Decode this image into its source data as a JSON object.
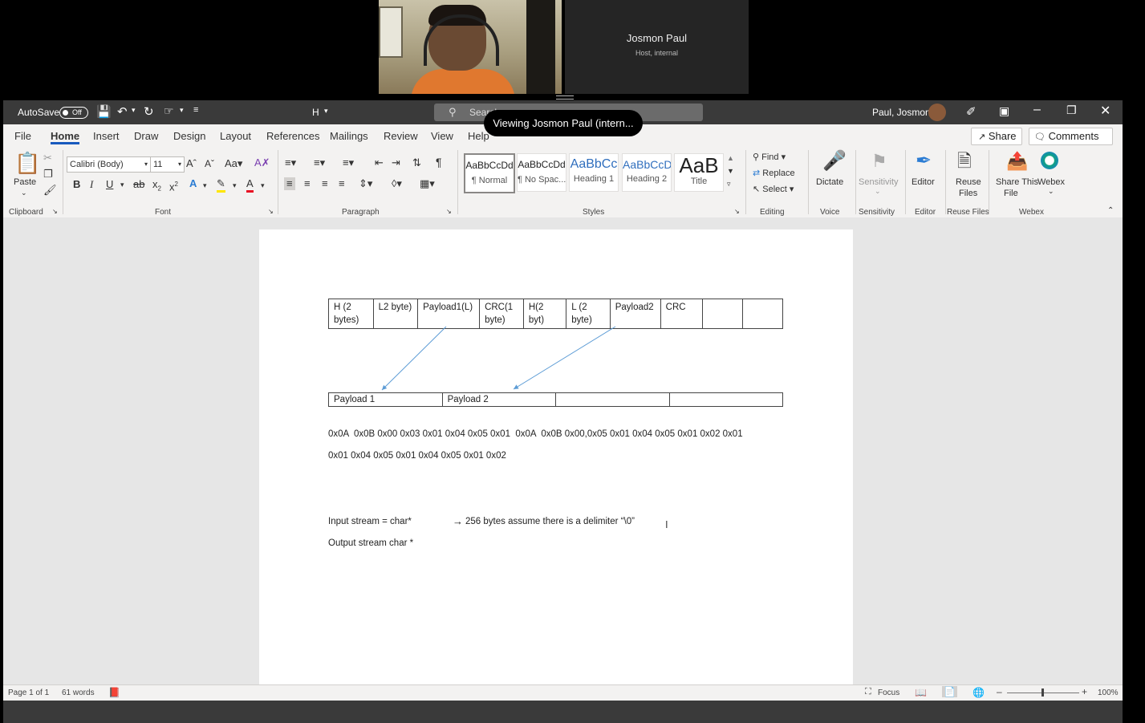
{
  "meeting": {
    "host_name": "Josmon Paul",
    "host_role": "Host, internal",
    "viewing_pill": "Viewing Josmon Paul (intern..."
  },
  "titlebar": {
    "autosave_label": "AutoSave",
    "autosave_state": "Off",
    "doc_title": "H",
    "search_placeholder": "Search",
    "user_name": "Paul, Josmon"
  },
  "tabs": [
    "File",
    "Home",
    "Insert",
    "Draw",
    "Design",
    "Layout",
    "References",
    "Mailings",
    "Review",
    "View",
    "Help"
  ],
  "share_label": "Share",
  "comments_label": "Comments",
  "ribbon": {
    "clipboard": {
      "paste": "Paste",
      "label": "Clipboard"
    },
    "font": {
      "name": "Calibri (Body)",
      "size": "11",
      "label": "Font"
    },
    "paragraph": {
      "label": "Paragraph"
    },
    "styles": {
      "label": "Styles",
      "items": [
        {
          "sample": "AaBbCcDd",
          "name": "¶ Normal"
        },
        {
          "sample": "AaBbCcDd",
          "name": "¶ No Spac..."
        },
        {
          "sample": "AaBbCc",
          "name": "Heading 1"
        },
        {
          "sample": "AaBbCcD",
          "name": "Heading 2"
        },
        {
          "sample": "AaB",
          "name": "Title"
        }
      ]
    },
    "editing": {
      "find": "Find",
      "replace": "Replace",
      "select": "Select",
      "label": "Editing"
    },
    "voice": {
      "dictate": "Dictate",
      "label": "Voice"
    },
    "sensitivity": {
      "button": "Sensitivity",
      "label": "Sensitivity"
    },
    "editor": {
      "button": "Editor",
      "label": "Editor"
    },
    "reuse": {
      "button1": "Reuse",
      "button2": "Files",
      "label": "Reuse Files"
    },
    "webex": {
      "share1": "Share This",
      "share2": "File",
      "webex": "Webex",
      "label": "Webex"
    }
  },
  "document": {
    "table1": [
      [
        "H (2 bytes)",
        "L2 byte)",
        "Payload1(L)",
        "CRC(1 byte)",
        "H(2 byt)",
        "L (2 byte)",
        "Payload2",
        "CRC",
        "",
        ""
      ]
    ],
    "table2": [
      [
        "Payload 1",
        "Payload 2",
        "",
        ""
      ]
    ],
    "line1": "0x0A  0x0B 0x00 0x03 0x01 0x04 0x05 0x01  0x0A  0x0B 0x00,0x05 0x01 0x04 0x05 0x01 0x02 0x01",
    "line2": "0x01 0x04 0x05 0x01 0x04 0x05 0x01 0x02",
    "input_left": "Input stream = char*",
    "input_right": "256 bytes assume there is a delimiter “\\0”",
    "output_line": "Output stream char *"
  },
  "statusbar": {
    "page": "Page 1 of 1",
    "words": "61 words",
    "focus": "Focus",
    "zoom": "100%"
  }
}
